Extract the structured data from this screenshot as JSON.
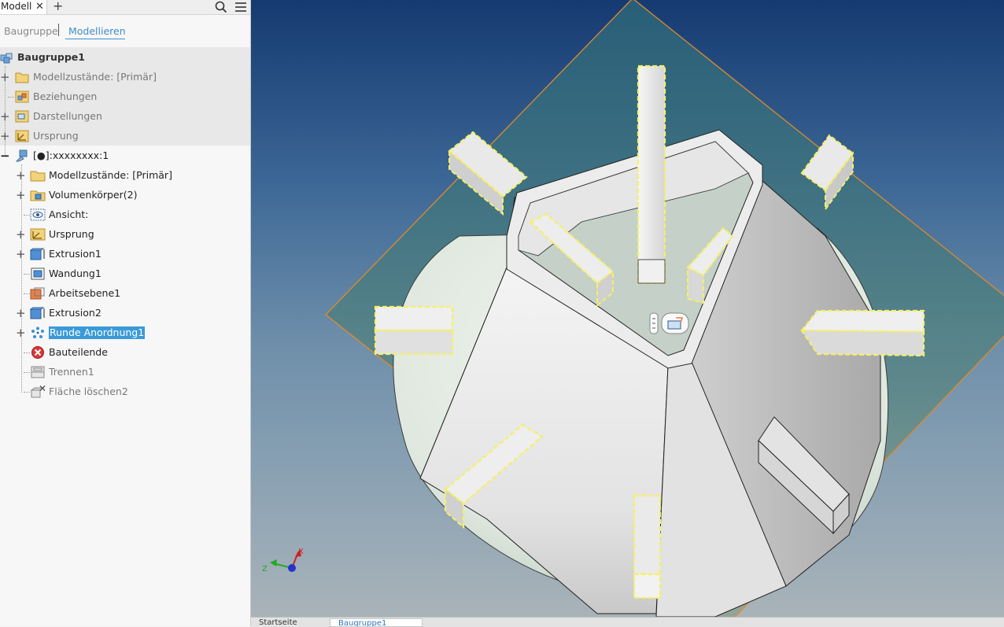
{
  "browser_tab": {
    "label": "Modell",
    "close": "✕",
    "add": "+"
  },
  "sub_tabs": {
    "first": "Baugruppe",
    "second": "Modellieren"
  },
  "tree": {
    "root": "Baugruppe1",
    "root_items": [
      {
        "label": "Modellzustände: [Primär]",
        "expander": "+"
      },
      {
        "label": "Beziehungen",
        "expander": ""
      },
      {
        "label": "Darstellungen",
        "expander": "+"
      },
      {
        "label": "Ursprung",
        "expander": "+"
      }
    ],
    "part": {
      "label": "[●]:xxxxxxxx:1",
      "expander": "−"
    },
    "part_items": [
      {
        "label": "Modellzustände: [Primär]",
        "expander": "+"
      },
      {
        "label": "Volumenkörper(2)",
        "expander": "+"
      },
      {
        "label": "Ansicht:",
        "expander": ""
      },
      {
        "label": "Ursprung",
        "expander": "+"
      },
      {
        "label": "Extrusion1",
        "expander": "+"
      },
      {
        "label": "Wandung1",
        "expander": ""
      },
      {
        "label": "Arbeitsebene1",
        "expander": ""
      },
      {
        "label": "Extrusion2",
        "expander": "+"
      },
      {
        "label": "Runde Anordnung1",
        "expander": "+"
      },
      {
        "label": "Bauteilende",
        "expander": ""
      },
      {
        "label": "Trennen1",
        "expander": ""
      },
      {
        "label": "Fläche löschen2",
        "expander": ""
      }
    ]
  },
  "triad": {
    "x": "X",
    "z": "Z"
  },
  "bottom_tabs": {
    "first": "Startseite",
    "second": "Baugruppe1"
  },
  "colors": {
    "accent": "#3a9ad9",
    "selection_outline": "#f5f066",
    "sketch_plane": "#e08a2c"
  }
}
